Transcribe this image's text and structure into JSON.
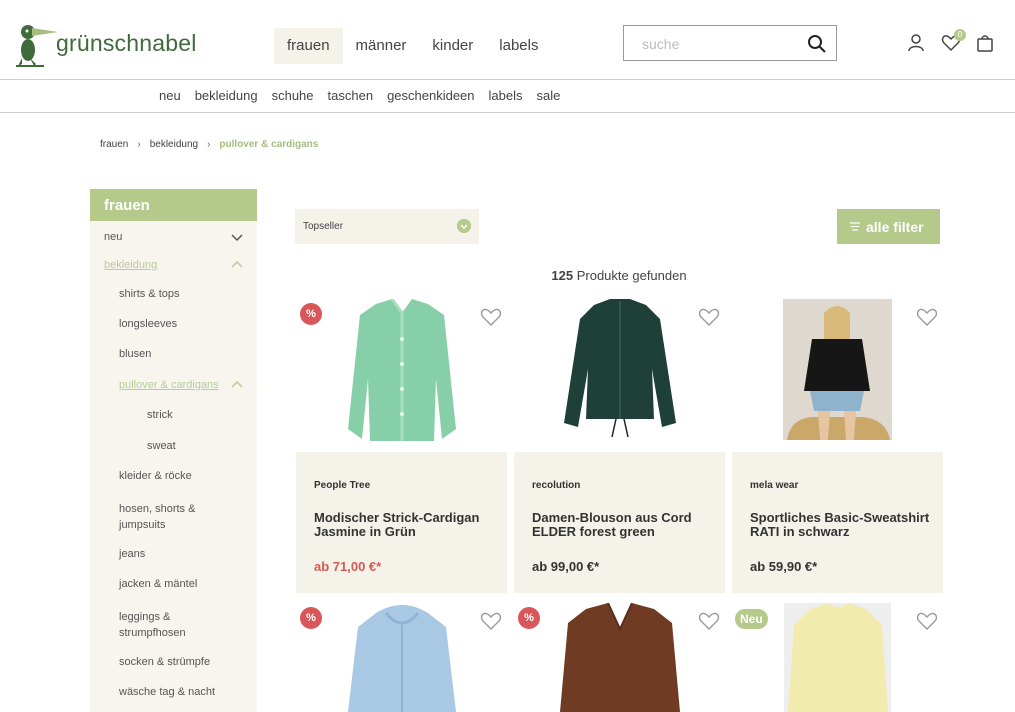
{
  "brand": {
    "name": "grünschnabel",
    "accent": "#b5c98b",
    "sale_color": "#d45a52"
  },
  "main_nav": [
    "frauen",
    "männer",
    "kinder",
    "labels"
  ],
  "search": {
    "placeholder": "suche"
  },
  "header_icons": {
    "account": "user-icon",
    "wishlist": "heart-icon",
    "wishlist_count": "0",
    "cart": "bag-icon"
  },
  "sub_nav": [
    "neu",
    "bekleidung",
    "schuhe",
    "taschen",
    "geschenkideen",
    "labels",
    "sale"
  ],
  "breadcrumb": [
    "frauen",
    "bekleidung",
    "pullover & cardigans"
  ],
  "sidebar": {
    "title": "frauen",
    "items": [
      "neu",
      "bekleidung",
      "shirts & tops",
      "longsleeves",
      "blusen",
      "pullover & cardigans",
      "strick",
      "sweat",
      "kleider & röcke",
      "hosen, shorts &",
      "jumpsuits",
      "jeans",
      "jacken & mäntel",
      "leggings &",
      "strumpfhosen",
      "socken & strümpfe",
      "wäsche tag & nacht"
    ]
  },
  "toolbar": {
    "sort_label": "Topseller",
    "filter_label": "alle filter",
    "count": "125",
    "count_suffix": " Produkte gefunden"
  },
  "products": [
    {
      "brand": "People Tree",
      "name": "Modischer Strick-Cardigan Jasmine in Grün",
      "price": "ab 71,00 €*",
      "badge": "%"
    },
    {
      "brand": "recolution",
      "name": "Damen-Blouson aus Cord ELDER forest green",
      "price": "ab 99,00 €*"
    },
    {
      "brand": "mela wear",
      "name": "Sportliches Basic-Sweatshirt RATI in schwarz",
      "price": "ab 59,90 €*"
    },
    {
      "badge": "%"
    },
    {
      "badge": "%"
    },
    {
      "badge": "Neu"
    }
  ]
}
